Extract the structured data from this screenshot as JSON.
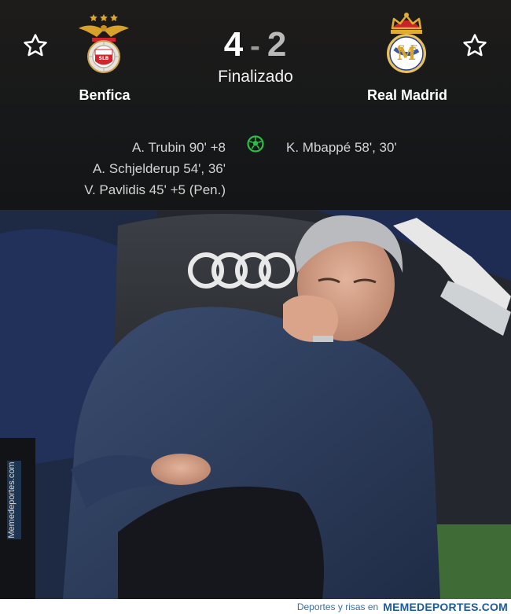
{
  "match": {
    "home_team": "Benfica",
    "away_team": "Real Madrid",
    "home_score": "4",
    "separator": "-",
    "away_score": "2",
    "status": "Finalizado"
  },
  "scorers": {
    "home": [
      "A. Trubin 90' +8",
      "A. Schjelderup 54', 36'",
      "V. Pavlidis 45' +5 (Pen.)"
    ],
    "away": [
      "K. Mbappé 58', 30'"
    ]
  },
  "watermarks": {
    "side": "Memedeportes.com",
    "footer_tag": "Deportes y risas en",
    "footer_brand": "MEMEDEPORTES.COM"
  },
  "icons": {
    "favorite": "star-outline-icon",
    "goal": "soccer-ball-icon",
    "home_crest": "benfica-crest",
    "away_crest": "real-madrid-crest"
  },
  "colors": {
    "background": "#15181b",
    "goal_icon": "#2bbf4a",
    "benfica_red": "#d1252d",
    "madrid_gold": "#d4a52a"
  }
}
